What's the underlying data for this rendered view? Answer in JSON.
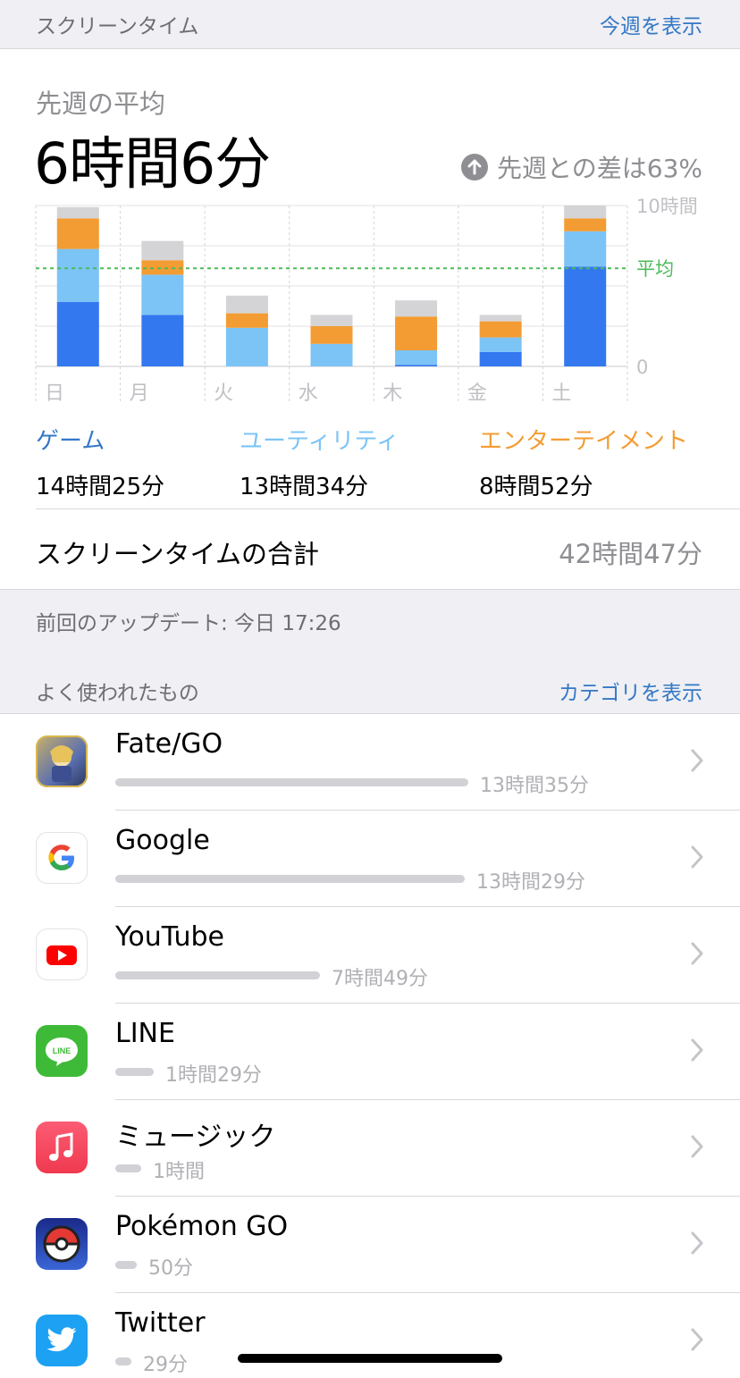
{
  "header": {
    "title": "スクリーンタイム",
    "action": "今週を表示"
  },
  "summary": {
    "average_label": "先週の平均",
    "average_value": "6時間6分",
    "diff_text": "先週との差は63%"
  },
  "chart_data": {
    "type": "bar",
    "stacked": true,
    "categories": [
      "日",
      "月",
      "火",
      "水",
      "木",
      "金",
      "土"
    ],
    "unit": "時間",
    "ylim": [
      0,
      10
    ],
    "y_tick_labels": [
      "10時間",
      "0"
    ],
    "average_label": "平均",
    "average_value": 6.1,
    "grid": true,
    "series": [
      {
        "name": "ゲーム",
        "color": "#3478f0",
        "values": [
          4.0,
          3.2,
          0,
          0,
          0.1,
          0.9,
          6.2
        ]
      },
      {
        "name": "ユーティリティ",
        "color": "#7cc4f5",
        "values": [
          3.3,
          2.5,
          2.4,
          1.4,
          0.9,
          0.9,
          2.2
        ]
      },
      {
        "name": "エンターテイメント",
        "color": "#f39c33",
        "values": [
          1.9,
          0.9,
          0.9,
          1.1,
          2.1,
          1.0,
          0.8
        ]
      },
      {
        "color": "#d4d4d6",
        "values": [
          0.7,
          1.2,
          1.1,
          0.7,
          1.0,
          0.4,
          0.8
        ]
      }
    ]
  },
  "categories": [
    {
      "name": "ゲーム",
      "value": "14時間25分",
      "color": "#3478c5"
    },
    {
      "name": "ユーティリティ",
      "value": "13時間34分",
      "color": "#7cc4f5"
    },
    {
      "name": "エンターテイメント",
      "value": "8時間52分",
      "color": "#f39c33"
    }
  ],
  "total": {
    "label": "スクリーンタイムの合計",
    "value": "42時間47分"
  },
  "update_text": "前回のアップデート: 今日 17:26",
  "most_used": {
    "title": "よく使われたもの",
    "action": "カテゴリを表示",
    "apps": [
      {
        "name": "Fate/GO",
        "duration": "13時間35分",
        "fraction": 1.0,
        "icon": "fate-go-icon"
      },
      {
        "name": "Google",
        "duration": "13時間29分",
        "fraction": 0.99,
        "icon": "google-icon"
      },
      {
        "name": "YouTube",
        "duration": "7時間49分",
        "fraction": 0.58,
        "icon": "youtube-icon"
      },
      {
        "name": "LINE",
        "duration": "1時間29分",
        "fraction": 0.11,
        "icon": "line-icon"
      },
      {
        "name": "ミュージック",
        "duration": "1時間",
        "fraction": 0.074,
        "icon": "music-icon"
      },
      {
        "name": "Pokémon GO",
        "duration": "50分",
        "fraction": 0.061,
        "icon": "pokemon-go-icon"
      },
      {
        "name": "Twitter",
        "duration": "29分",
        "fraction": 0.036,
        "icon": "twitter-icon"
      }
    ]
  }
}
